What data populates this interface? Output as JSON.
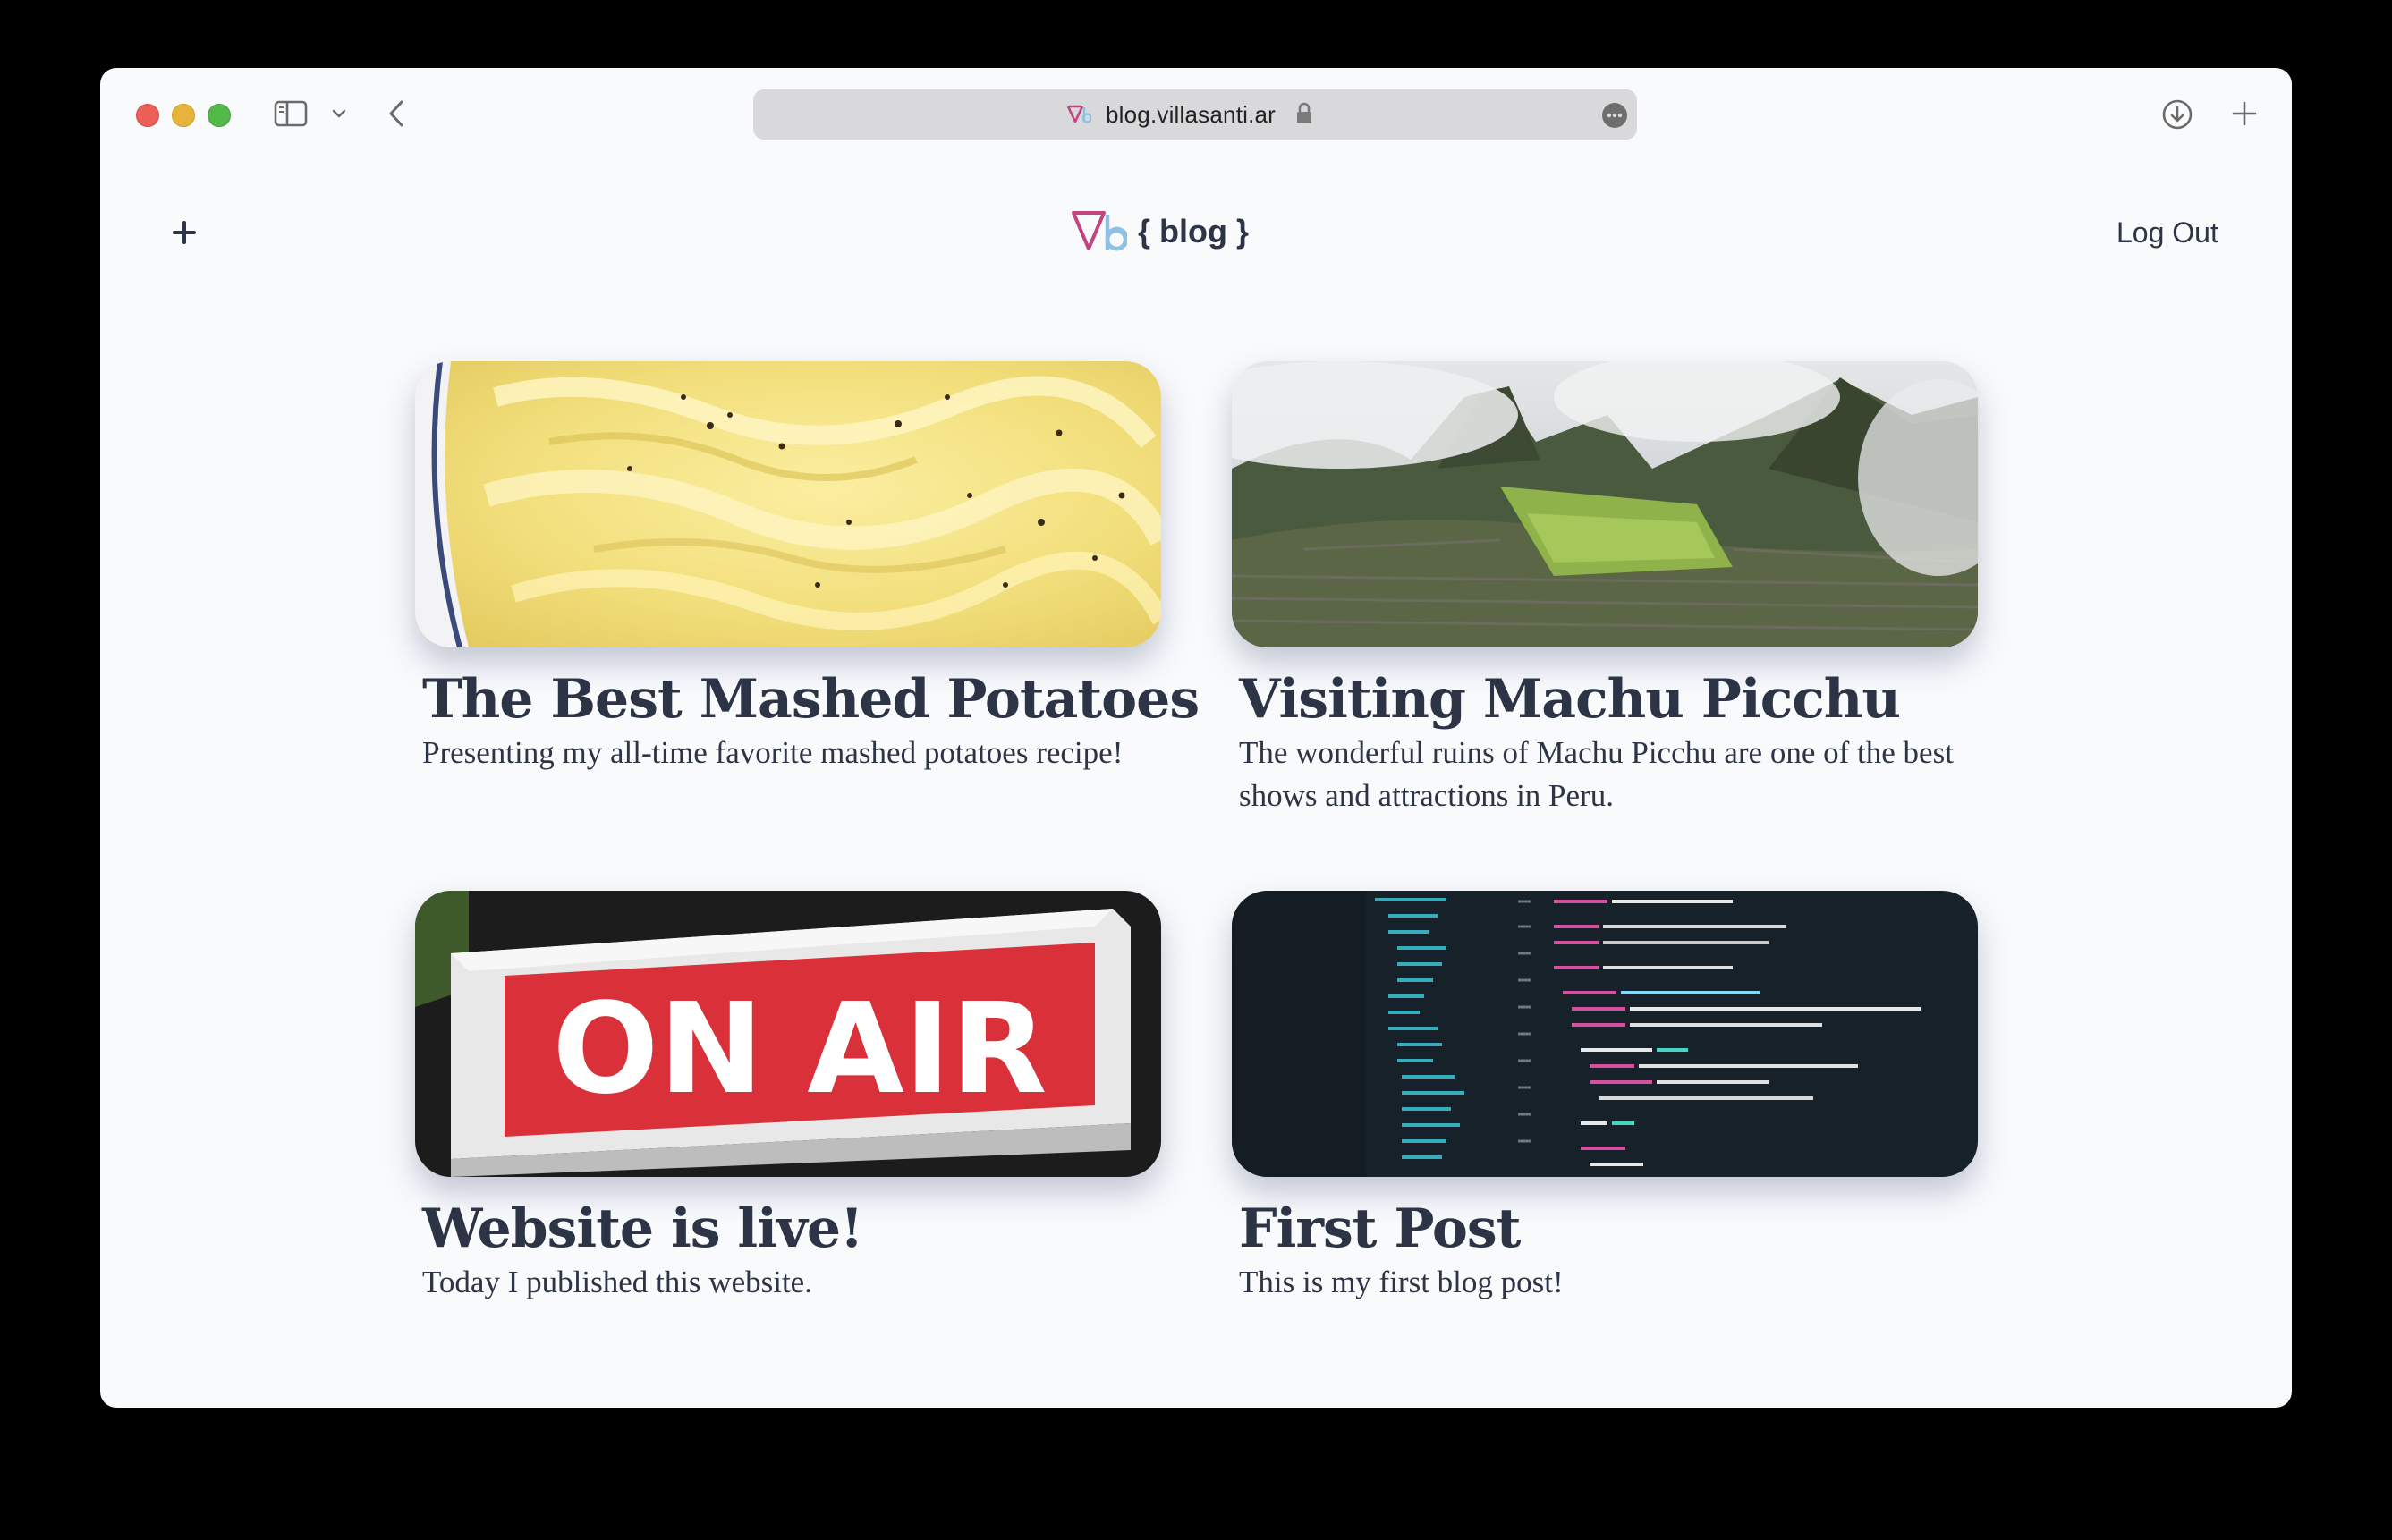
{
  "browser": {
    "url": "blog.villasanti.ar"
  },
  "header": {
    "logo_text": "{ blog }",
    "logout_label": "Log Out"
  },
  "posts": [
    {
      "title": "The Best Mashed Potatoes",
      "description": "Presenting my all-time favorite mashed potatoes recipe!",
      "image": "mashed-potatoes-photo"
    },
    {
      "title": "Visiting Machu Picchu",
      "description": "The wonderful ruins of Machu Picchu are one of the best shows and attractions in Peru.",
      "image": "machu-picchu-photo"
    },
    {
      "title": "Website is live!",
      "description": "Today I published this website.",
      "image": "on-air-sign-photo",
      "image_text": "ON AIR"
    },
    {
      "title": "First Post",
      "description": "This is my first blog post!",
      "image": "code-editor-photo"
    }
  ],
  "colors": {
    "page_bg": "#f8fafc",
    "text": "#2c3446",
    "logo_pink": "#c2457f",
    "logo_blue": "#8fc1e3"
  }
}
